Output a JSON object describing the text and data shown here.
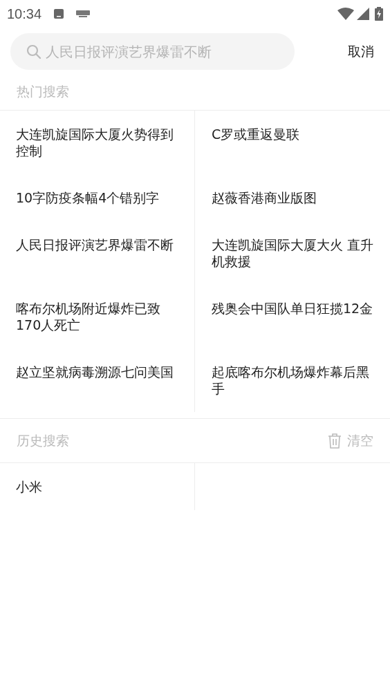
{
  "status_bar": {
    "time": "10:34"
  },
  "search": {
    "placeholder": "人民日报评演艺界爆雷不断",
    "cancel": "取消"
  },
  "hot": {
    "title": "热门搜索",
    "items": [
      {
        "text": "大连凯旋国际大厦火势得到控制"
      },
      {
        "text": "C罗或重返曼联"
      },
      {
        "text": "10字防疫条幅4个错别字"
      },
      {
        "text": "赵薇香港商业版图"
      },
      {
        "text": "人民日报评演艺界爆雷不断"
      },
      {
        "text": "大连凯旋国际大厦大火 直升机救援"
      },
      {
        "text": "喀布尔机场附近爆炸已致170人死亡"
      },
      {
        "text": "残奥会中国队单日狂揽12金"
      },
      {
        "text": "赵立坚就病毒溯源七问美国"
      },
      {
        "text": "起底喀布尔机场爆炸幕后黑手"
      }
    ]
  },
  "history": {
    "title": "历史搜索",
    "clear": "清空",
    "items": [
      {
        "text": "小米"
      }
    ]
  }
}
